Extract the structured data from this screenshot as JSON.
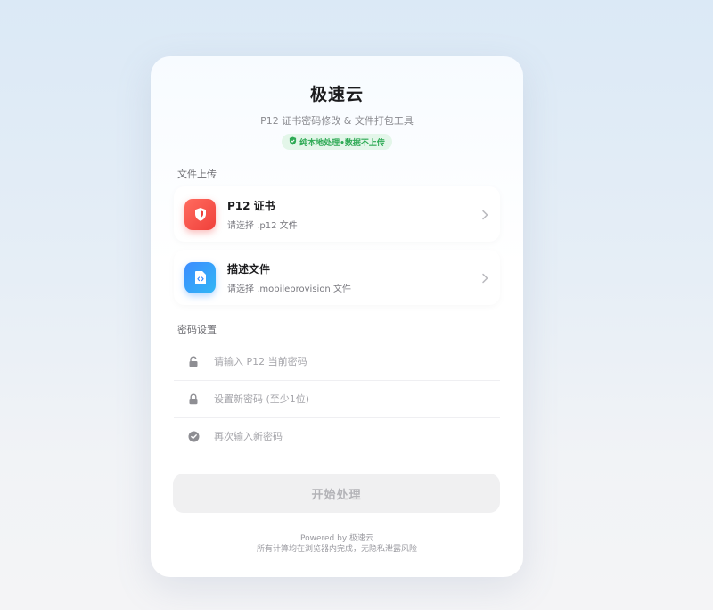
{
  "app": {
    "title": "极速云",
    "subtitle": "P12 证书密码修改 & 文件打包工具",
    "badge": "纯本地处理•数据不上传"
  },
  "upload": {
    "section_label": "文件上传",
    "items": [
      {
        "title": "P12 证书",
        "hint": "请选择 .p12 文件",
        "icon": "shield-icon",
        "color": "#f0403b"
      },
      {
        "title": "描述文件",
        "hint": "请选择 .mobileprovision 文件",
        "icon": "code-file-icon",
        "color": "#3b8cff"
      }
    ]
  },
  "password": {
    "section_label": "密码设置",
    "fields": [
      {
        "placeholder": "请输入 P12 当前密码",
        "icon": "unlock-icon"
      },
      {
        "placeholder": "设置新密码 (至少1位)",
        "icon": "lock-icon"
      },
      {
        "placeholder": "再次输入新密码",
        "icon": "check-circle-icon"
      }
    ]
  },
  "submit_label": "开始处理",
  "footer": {
    "powered": "Powered by 极速云",
    "note": "所有计算均在浏览器内完成，无隐私泄露风险"
  },
  "colors": {
    "accent_green": "#2eaa55",
    "badge_bg": "#e3f6e9"
  }
}
